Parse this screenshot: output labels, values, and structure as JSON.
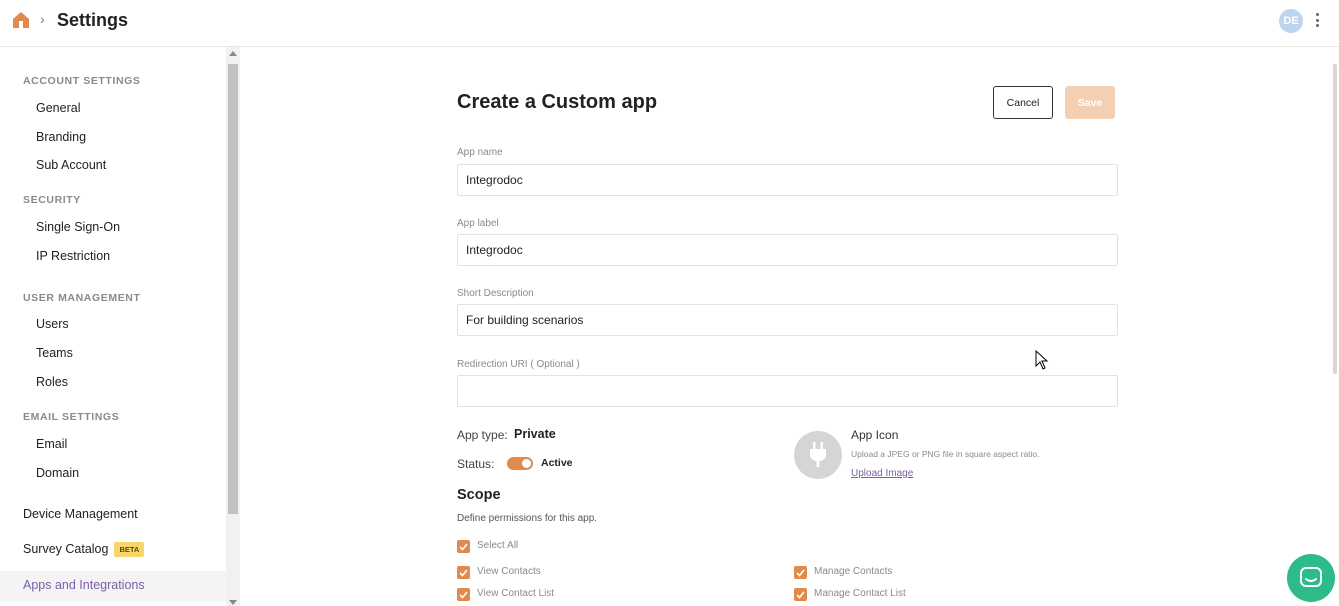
{
  "header": {
    "title": "Settings",
    "avatar_initials": "DE",
    "home_icon": "home-icon",
    "menu_icon": "kebab-menu-icon"
  },
  "sidebar": {
    "sections": [
      {
        "title": "ACCOUNT SETTINGS",
        "items": [
          "General",
          "Branding",
          "Sub Account"
        ]
      },
      {
        "title": "SECURITY",
        "items": [
          "Single Sign-On",
          "IP Restriction"
        ]
      },
      {
        "title": "USER MANAGEMENT",
        "items": [
          "Users",
          "Teams",
          "Roles"
        ]
      },
      {
        "title": "EMAIL SETTINGS",
        "items": [
          "Email",
          "Domain"
        ]
      }
    ],
    "top_items": {
      "device_management": "Device Management",
      "survey_catalog": "Survey Catalog",
      "survey_catalog_badge": "BETA",
      "apps_integrations": "Apps and Integrations"
    }
  },
  "form": {
    "title": "Create a Custom app",
    "cancel_label": "Cancel",
    "save_label": "Save",
    "fields": {
      "app_name": {
        "label": "App name",
        "value": "Integrodoc"
      },
      "app_label": {
        "label": "App label",
        "value": "Integrodoc"
      },
      "short_description": {
        "label": "Short Description",
        "value": "For building scenarios"
      },
      "redirection_uri": {
        "label": "Redirection URI ( Optional )",
        "value": ""
      }
    },
    "app_type_label": "App type:",
    "app_type_value": "Private",
    "status_label": "Status:",
    "status_value": "Active",
    "status_on": true,
    "app_icon": {
      "title": "App Icon",
      "help": "Upload a JPEG or PNG file in square aspect ratio.",
      "upload_label": "Upload Image",
      "icon": "plug-icon"
    },
    "scope": {
      "title": "Scope",
      "subtitle": "Define permissions for this app.",
      "select_all": "Select All",
      "permissions_left": [
        "View Contacts",
        "View Contact List"
      ],
      "permissions_right": [
        "Manage Contacts",
        "Manage Contact List"
      ]
    }
  },
  "colors": {
    "accent": "#e08a4c",
    "save_disabled": "#f3cfb3",
    "link": "#7b5ea7",
    "chat": "#2dbb8a",
    "beta_badge": "#f6d66b"
  }
}
